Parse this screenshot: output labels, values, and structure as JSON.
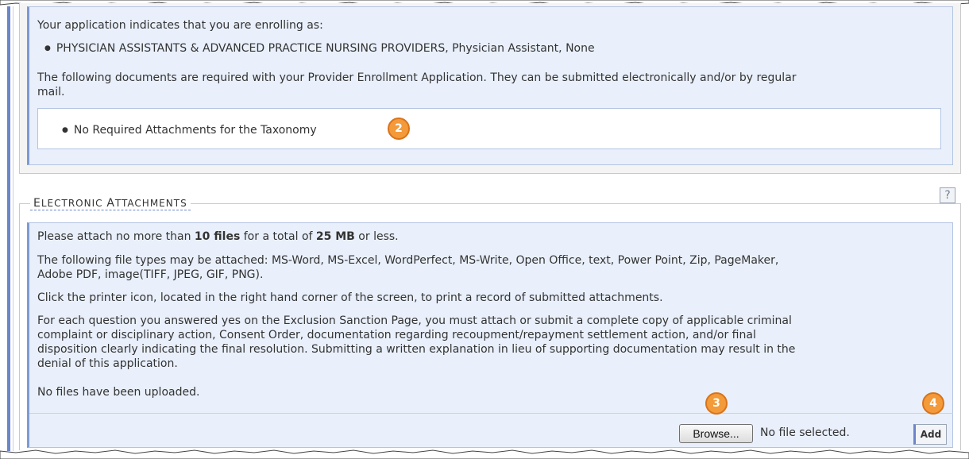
{
  "enrollment": {
    "intro": "Your application indicates that you are enrolling as:",
    "role": "PHYSICIAN ASSISTANTS & ADVANCED PRACTICE NURSING PROVIDERS, Physician Assistant, None",
    "required_docs_line1": "The following documents are required with your Provider Enrollment Application. They can be submitted electronically and/or by regular",
    "required_docs_line2": "mail.",
    "attachment_item": "No Required Attachments for the Taxonomy"
  },
  "callouts": {
    "c2": "2",
    "c3": "3",
    "c4": "4"
  },
  "electronic": {
    "legend_first_E": "E",
    "legend_rest1": "LECTRONIC ",
    "legend_first_A": "A",
    "legend_rest2": "TTACHMENTS",
    "help": "?",
    "limit_pre": "Please attach no more than ",
    "limit_files": "10 files",
    "limit_mid": " for a total of ",
    "limit_size": "25 MB",
    "limit_post": " or less.",
    "types_line1": "The following file types may be attached: MS-Word, MS-Excel, WordPerfect, MS-Write, Open Office, text, Power Point, Zip, PageMaker,",
    "types_line2": "Adobe PDF, image(TIFF, JPEG, GIF, PNG).",
    "printer_note": "Click the printer icon, located in the right hand corner of the screen, to print a record of submitted attachments.",
    "exclusion_line1": "For each question you answered yes on the Exclusion Sanction Page, you must attach or submit a complete copy of applicable criminal",
    "exclusion_line2": "complaint or disciplinary action, Consent Order, documentation regarding recoupment/repayment settlement action, and/or final",
    "exclusion_line3": "disposition clearly indicating the final resolution. Submitting a written explanation in lieu of supporting documentation may result in the",
    "exclusion_line4": "denial of this application.",
    "no_files": "No files have been uploaded.",
    "browse_label": "Browse...",
    "file_status": "No file selected.",
    "add_label": "Add"
  }
}
